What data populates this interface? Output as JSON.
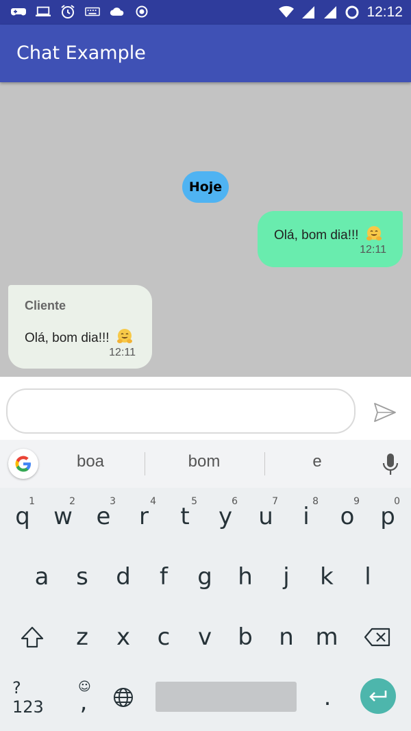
{
  "status_bar": {
    "time": "12:12",
    "left_icons": [
      "gamepad-icon",
      "laptop-icon",
      "alarm-icon",
      "keyboard-icon",
      "cloud-icon",
      "record-icon"
    ],
    "right_icons": [
      "wifi-icon",
      "signal-icon",
      "signal-icon",
      "battery-icon"
    ]
  },
  "app_bar": {
    "title": "Chat Example"
  },
  "chat": {
    "date_chip": "Hoje",
    "outgoing": {
      "text": "Olá, bom dia!!!",
      "emoji": "hugging-face",
      "time": "12:11"
    },
    "incoming": {
      "sender": "Cliente",
      "text": "Olá, bom dia!!!",
      "emoji": "hugging-face",
      "time": "12:11"
    }
  },
  "composer": {
    "value": "",
    "placeholder": "",
    "send_icon": "send-icon"
  },
  "suggestions": [
    "boa",
    "bom",
    "e"
  ],
  "keyboard": {
    "row1": [
      {
        "label": "q",
        "hint": "1"
      },
      {
        "label": "w",
        "hint": "2"
      },
      {
        "label": "e",
        "hint": "3"
      },
      {
        "label": "r",
        "hint": "4"
      },
      {
        "label": "t",
        "hint": "5"
      },
      {
        "label": "y",
        "hint": "6"
      },
      {
        "label": "u",
        "hint": "7"
      },
      {
        "label": "i",
        "hint": "8"
      },
      {
        "label": "o",
        "hint": "9"
      },
      {
        "label": "p",
        "hint": "0"
      }
    ],
    "row2": [
      "a",
      "s",
      "d",
      "f",
      "g",
      "h",
      "j",
      "k",
      "l"
    ],
    "row3": [
      "z",
      "x",
      "c",
      "v",
      "b",
      "n",
      "m"
    ],
    "symbols_label": "?123",
    "comma_label": ",",
    "period_label": "."
  },
  "colors": {
    "status_bar": "#2f3c9c",
    "app_bar": "#3f51b5",
    "chat_bg": "#c3c3c3",
    "outgoing_bubble": "#69ecae",
    "incoming_bubble": "#ebf1e9",
    "date_chip": "#4fb3f2",
    "enter_key": "#4db6ac"
  }
}
